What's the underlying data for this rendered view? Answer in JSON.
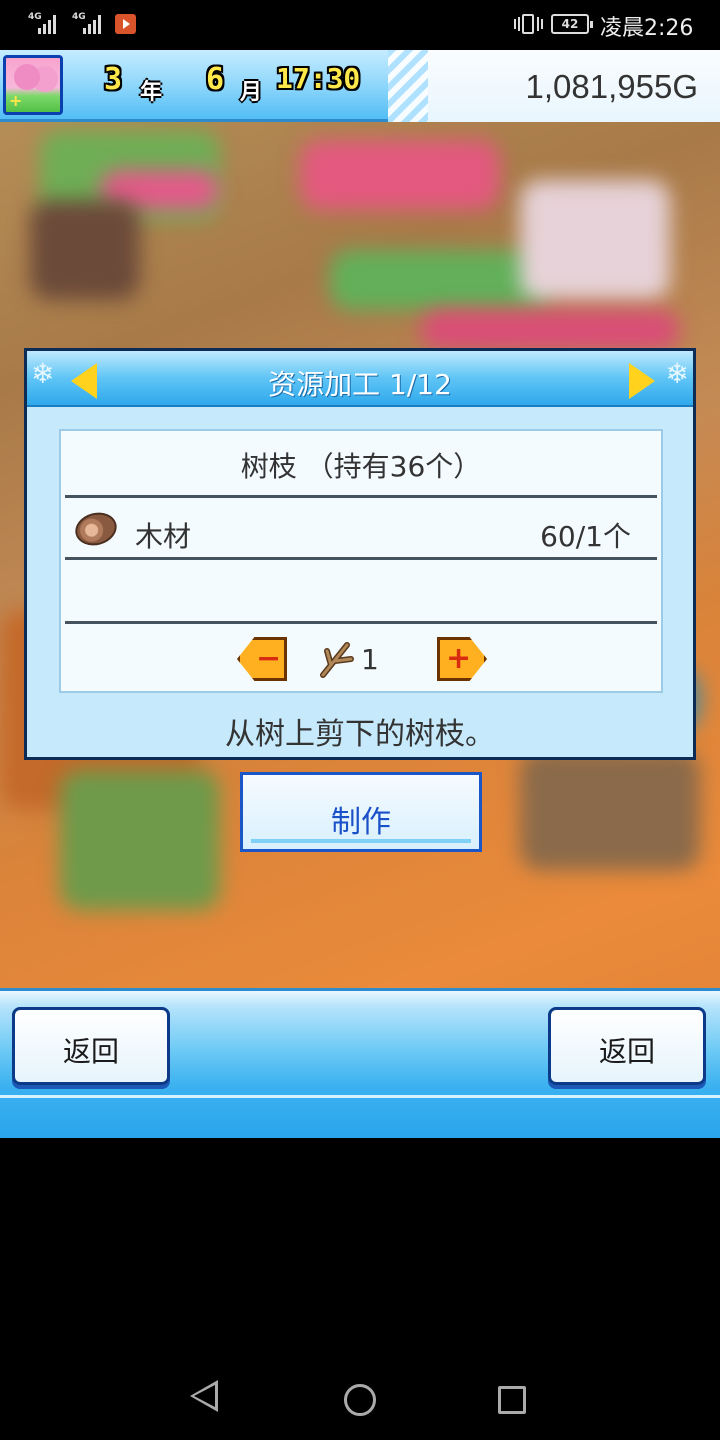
{
  "status_bar": {
    "signal1_label": "4G",
    "signal2_label": "4G",
    "battery": "42",
    "time": "凌晨2:26"
  },
  "hud": {
    "year": "3",
    "year_unit": "年",
    "month": "6",
    "month_unit": "月",
    "clock": "17:30",
    "money": "1,081,955G"
  },
  "dialog": {
    "title": "资源加工 1/12",
    "item_title": "树枝 （持有36个）",
    "material_name": "木材",
    "material_ratio": "60/1个",
    "quantity": "1",
    "description": "从树上剪下的树枝。"
  },
  "actions": {
    "make_label": "制作"
  },
  "bottom": {
    "back_left": "返回",
    "back_right": "返回"
  },
  "icons": {
    "log": "log-icon",
    "branch": "branch-icon",
    "prev": "prev-arrow-icon",
    "next": "next-arrow-icon"
  },
  "colors": {
    "accent_yellow": "#ffd21e",
    "button_orange": "#ffb020",
    "header_blue": "#2fa8ec",
    "make_text_blue": "#1a50c8"
  }
}
